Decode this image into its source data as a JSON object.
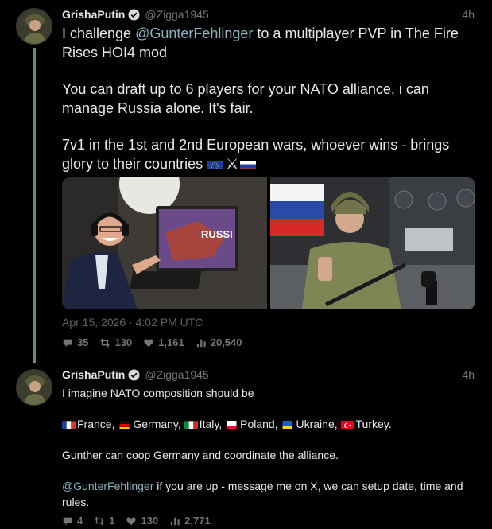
{
  "tweets": [
    {
      "user": {
        "display_name": "GrishaPutin",
        "handle": "@Zigga1945",
        "verified": true
      },
      "time": "4h",
      "text": {
        "line1_pre": "I challenge ",
        "line1_mention": "@GunterFehlinger",
        "line1_post": " to a multiplayer PVP in The Fire Rises HOI4 mod",
        "para2": "You can draft up to 6 players for your NATO alliance, i can manage Russia alone. It's fair.",
        "para3": "7v1 in the 1st and 2nd European wars, whoever wins - brings glory to their countries "
      },
      "emoji": [
        "eu-flag",
        "crossed-swords",
        "russia-flag"
      ],
      "media": [
        {
          "name": "photo-streamer-with-headset",
          "overlay_text": "RUSSI"
        },
        {
          "name": "photo-soldier-with-flag"
        }
      ],
      "date": "Apr 15, 2026 · 4:02 PM UTC",
      "stats": {
        "replies": "35",
        "retweets": "130",
        "likes": "1,161",
        "views": "20,540"
      }
    },
    {
      "user": {
        "display_name": "GrishaPutin",
        "handle": "@Zigga1945",
        "verified": true
      },
      "time": "4h",
      "text": {
        "line1": "I imagine NATO composition should be",
        "countries": [
          "France",
          "Germany",
          "Italy",
          "Poland",
          "Ukraine",
          "Turkey."
        ],
        "sep": ", ",
        "para3": "Gunther can coop Germany and coordinate the alliance.",
        "para4_mention": "@GunterFehlinger",
        "para4_post": " if you are up - message me on X, we can setup date, time and rules."
      },
      "stats": {
        "replies": "4",
        "retweets": "1",
        "likes": "130",
        "views": "2,771"
      }
    }
  ],
  "colors": {
    "background": "#000000",
    "thread_line": "#5a8f87",
    "mention": "#8bb4bf",
    "muted": "#71767b"
  }
}
